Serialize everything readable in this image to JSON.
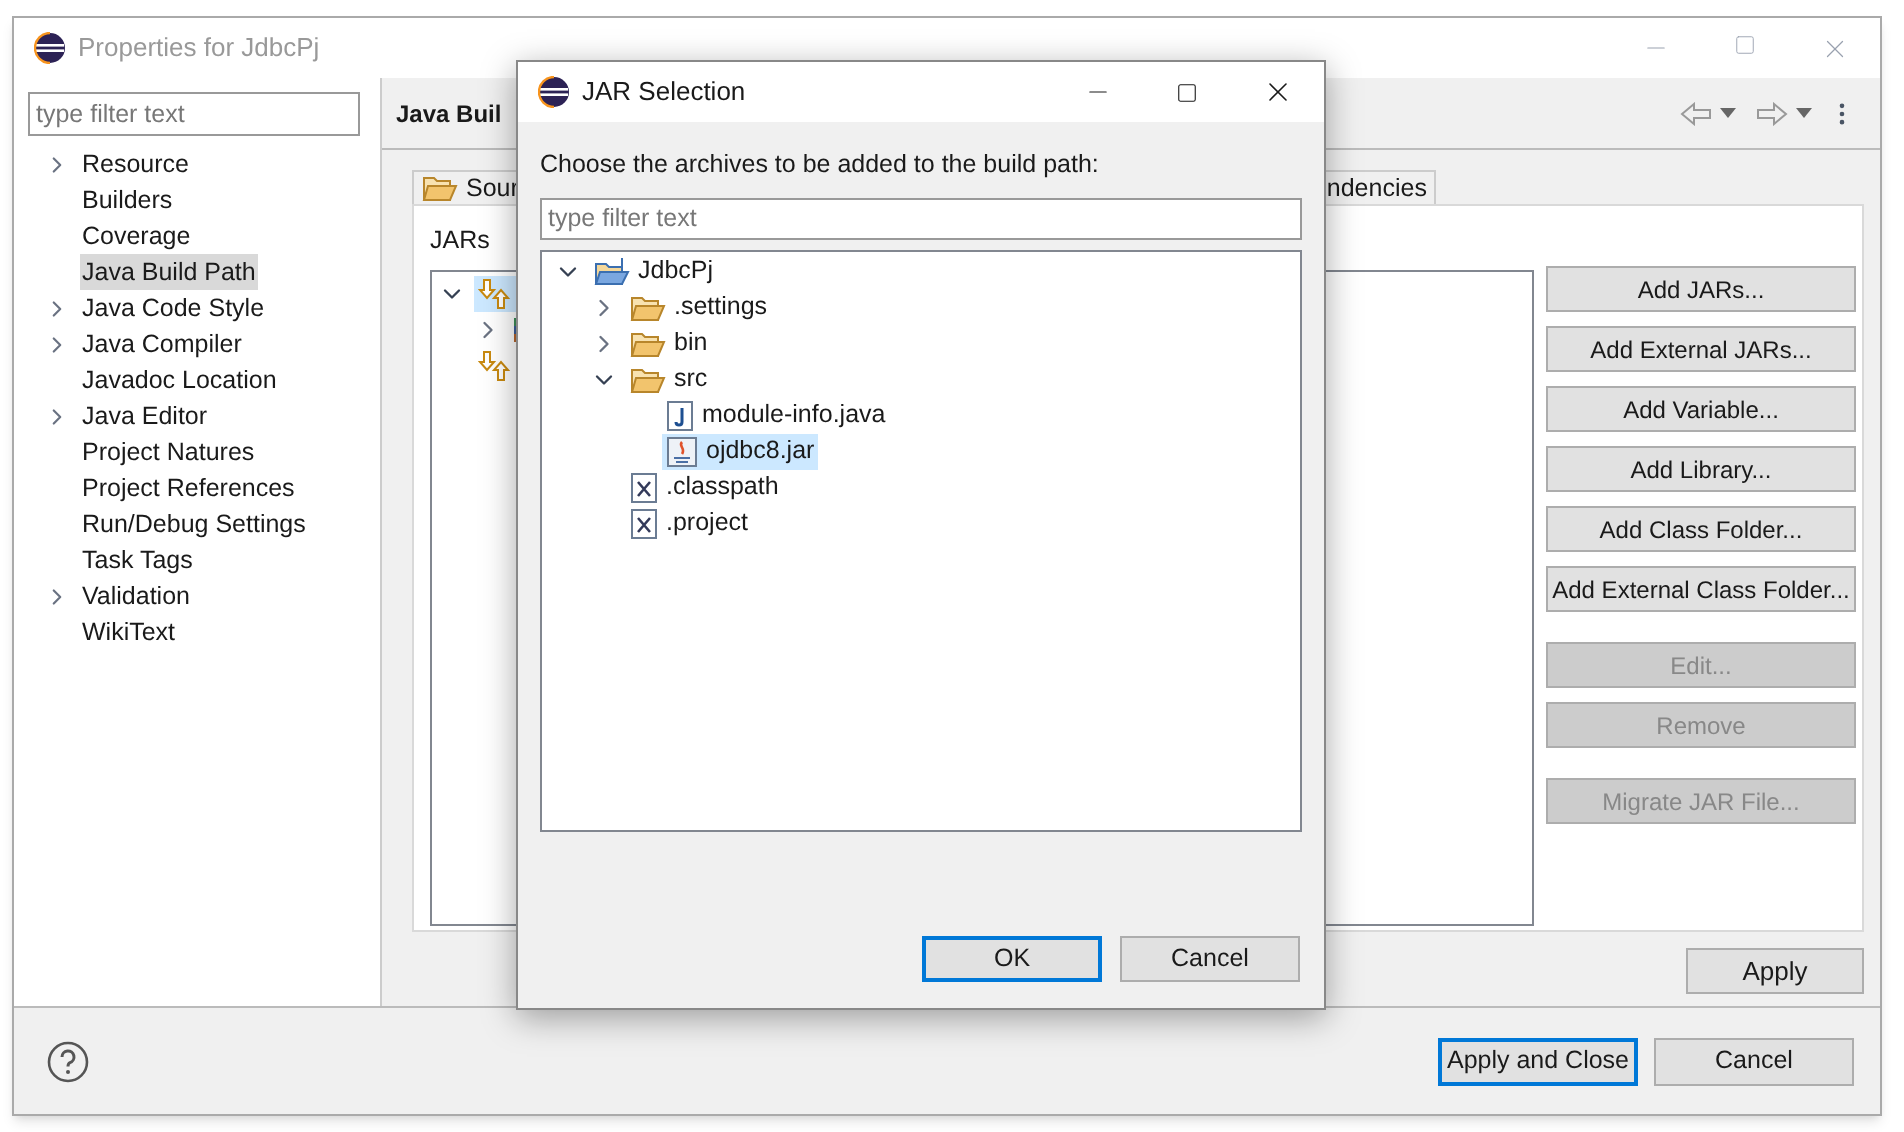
{
  "window": {
    "title": "Properties for JdbcPj"
  },
  "sidebar": {
    "filter": {
      "placeholder": "type filter text"
    },
    "items": [
      {
        "label": "Resource",
        "expandable": true,
        "selected": false
      },
      {
        "label": "Builders",
        "expandable": false,
        "selected": false
      },
      {
        "label": "Coverage",
        "expandable": false,
        "selected": false
      },
      {
        "label": "Java Build Path",
        "expandable": false,
        "selected": true
      },
      {
        "label": "Java Code Style",
        "expandable": true,
        "selected": false
      },
      {
        "label": "Java Compiler",
        "expandable": true,
        "selected": false
      },
      {
        "label": "Javadoc Location",
        "expandable": false,
        "selected": false
      },
      {
        "label": "Java Editor",
        "expandable": true,
        "selected": false
      },
      {
        "label": "Project Natures",
        "expandable": false,
        "selected": false
      },
      {
        "label": "Project References",
        "expandable": false,
        "selected": false
      },
      {
        "label": "Run/Debug Settings",
        "expandable": false,
        "selected": false
      },
      {
        "label": "Task Tags",
        "expandable": false,
        "selected": false
      },
      {
        "label": "Validation",
        "expandable": true,
        "selected": false
      },
      {
        "label": "WikiText",
        "expandable": false,
        "selected": false
      }
    ]
  },
  "page": {
    "title": "Java Buil",
    "tabs": [
      {
        "label": "Sour",
        "selected": false
      },
      {
        "label": "ndencies",
        "selected": false
      }
    ],
    "list_label": "JARs",
    "tree": [
      {
        "kind": "container",
        "expanded": true,
        "selected": true,
        "children": [
          {
            "kind": "library",
            "expanded": false,
            "selected": false
          }
        ]
      },
      {
        "kind": "container",
        "selected": false
      }
    ],
    "button_groups": [
      [
        {
          "label": "Add JARs...",
          "disabled": false
        },
        {
          "label": "Add External JARs...",
          "disabled": false
        },
        {
          "label": "Add Variable...",
          "disabled": false
        },
        {
          "label": "Add Library...",
          "disabled": false
        },
        {
          "label": "Add Class Folder...",
          "disabled": false
        },
        {
          "label": "Add External Class Folder...",
          "disabled": false
        }
      ],
      [
        {
          "label": "Edit...",
          "disabled": true
        },
        {
          "label": "Remove",
          "disabled": true
        }
      ],
      [
        {
          "label": "Migrate JAR File...",
          "disabled": true
        }
      ]
    ],
    "apply": "Apply"
  },
  "footer": {
    "buttons": [
      {
        "label": "Apply and Close",
        "default": true
      },
      {
        "label": "Cancel",
        "default": false
      }
    ]
  },
  "dialog": {
    "title": "JAR Selection",
    "message": "Choose the archives to be added to the build path:",
    "filter": {
      "placeholder": "type filter text"
    },
    "tree": [
      {
        "label": "JdbcPj",
        "kind": "project",
        "expanded": true,
        "selected": false,
        "children": [
          {
            "label": ".settings",
            "kind": "folder",
            "expanded": false,
            "selected": false
          },
          {
            "label": "bin",
            "kind": "folder",
            "expanded": false,
            "selected": false
          },
          {
            "label": "src",
            "kind": "folder",
            "expanded": true,
            "selected": false,
            "children": [
              {
                "label": "module-info.java",
                "kind": "java",
                "selected": false
              },
              {
                "label": "ojdbc8.jar",
                "kind": "jar",
                "selected": true
              }
            ]
          },
          {
            "label": ".classpath",
            "kind": "xml",
            "selected": false
          },
          {
            "label": ".project",
            "kind": "xml",
            "selected": false
          }
        ]
      }
    ],
    "buttons": [
      {
        "label": "OK",
        "default": true
      },
      {
        "label": "Cancel",
        "default": false
      }
    ]
  }
}
